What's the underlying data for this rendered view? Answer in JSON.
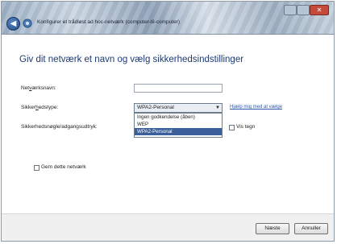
{
  "window": {
    "title": "Konfigurer et trådløst ad hoc-netværk (computer-til-computer)"
  },
  "page": {
    "heading": "Giv dit netværk et navn og vælg sikkerhedsindstillinger"
  },
  "form": {
    "network_name_label_pre": "Net",
    "network_name_label_u": "v",
    "network_name_label_post": "ærksnavn:",
    "network_name_value": "",
    "security_type_label_pre": "Sikker",
    "security_type_label_u": "h",
    "security_type_label_post": "edstype:",
    "security_type_value": "WPA2-Personal",
    "security_key_label": "Sikkerhedsnøgle/adgangsudtryk:",
    "help_link": "Hjælp mig med at vælge",
    "show_chars_label": "Vis tegn",
    "save_network_label": "Gem dette netværk",
    "security_options": [
      "Ingen godkendelse (åben)",
      "WEP",
      "WPA2-Personal"
    ]
  },
  "buttons": {
    "next": "Næste",
    "cancel": "Annuller"
  },
  "icons": {
    "back": "back-arrow-icon",
    "wizard": "network-wizard-icon",
    "dropdown": "chevron-down-icon"
  }
}
